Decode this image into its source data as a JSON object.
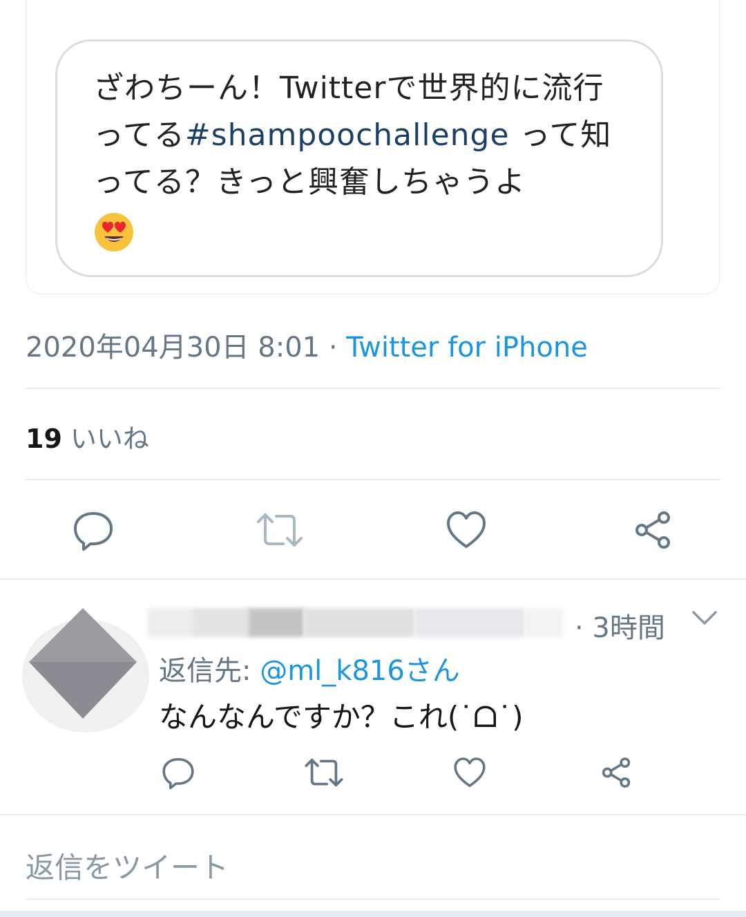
{
  "quoted_tweet": {
    "text_before": "ざわちーん！Twitterで世界的に流行ってる",
    "hashtag": "#shampoochallenge",
    "text_after": " って知ってる？きっと興奮しちゃうよ",
    "emoji": "heart-eyes-emoji"
  },
  "tweet_meta": {
    "timestamp": "2020年04月30日 8:01",
    "separator": " · ",
    "source": "Twitter for iPhone"
  },
  "stats": {
    "likes_count": "19",
    "likes_label": "いいね"
  },
  "actions": {
    "icons": [
      "reply-icon",
      "retweet-icon",
      "like-icon",
      "share-icon"
    ]
  },
  "reply": {
    "time": "· 3時間",
    "reply_to_label": "返信先: ",
    "reply_to_handle": "@ml_k816さん",
    "body": "なんなんですか？これ(˙ᗝ˙)"
  },
  "composer": {
    "placeholder": "返信をツイート"
  },
  "colors": {
    "accent": "#1b95e0",
    "muted": "#657786",
    "border": "#e6ecf0",
    "hashtag": "#1b3f66"
  }
}
